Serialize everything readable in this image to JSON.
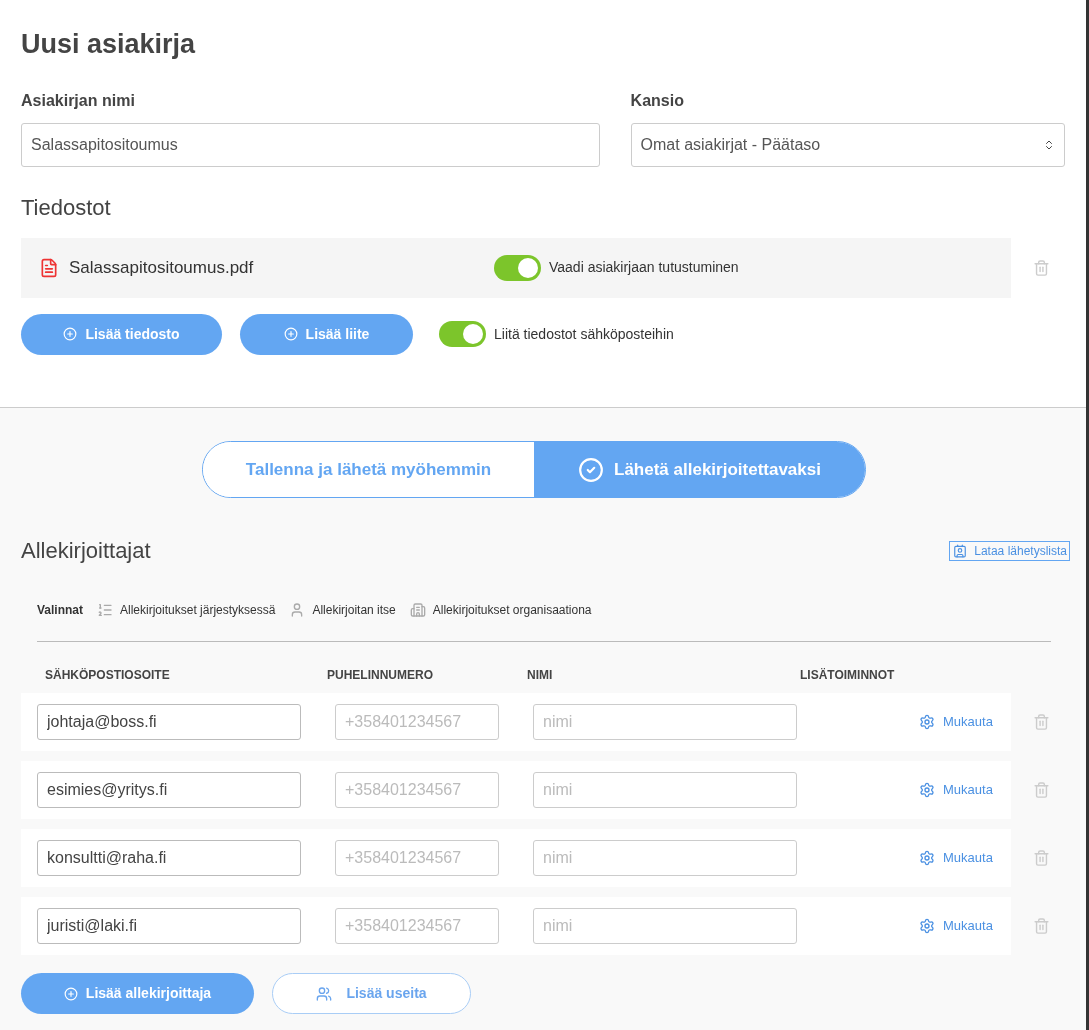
{
  "title": "Uusi asiakirja",
  "name_field": {
    "label": "Asiakirjan nimi",
    "value": "Salassapitositoumus"
  },
  "folder_field": {
    "label": "Kansio",
    "value": "Omat asiakirjat - Päätaso"
  },
  "files_heading": "Tiedostot",
  "files": [
    {
      "name": "Salassapitositoumus.pdf",
      "toggle_label": "Vaadi asiakirjaan tutustuminen",
      "on": true
    }
  ],
  "file_buttons": [
    "Lisää tiedosto",
    "Lisää liite"
  ],
  "attach_toggle": {
    "label": "Liitä tiedostot sähköposteihin",
    "on": true
  },
  "send_modes": [
    {
      "label": "Tallenna ja lähetä myöhemmin",
      "selected": false
    },
    {
      "label": "Lähetä allekirjoitettavaksi",
      "selected": true
    }
  ],
  "signers_heading": "Allekirjoittajat",
  "download_link": "Lataa lähetyslista",
  "options_label": "Valinnat",
  "options": [
    {
      "kind": "order",
      "label": "Allekirjoitukset järjestyksessä"
    },
    {
      "kind": "self",
      "label": "Allekirjoitan itse"
    },
    {
      "kind": "org",
      "label": "Allekirjoitukset organisaationa"
    }
  ],
  "columns": [
    "SÄHKÖPOSTIOSOITE",
    "PUHELINNUMERO",
    "NIMI",
    "LISÄTOIMINNOT"
  ],
  "signers": [
    {
      "email": "johtaja@boss.fi",
      "phone_placeholder": "+358401234567",
      "name_placeholder": "nimi",
      "action": "Mukauta"
    },
    {
      "email": "esimies@yritys.fi",
      "phone_placeholder": "+358401234567",
      "name_placeholder": "nimi",
      "action": "Mukauta"
    },
    {
      "email": "konsultti@raha.fi",
      "phone_placeholder": "+358401234567",
      "name_placeholder": "nimi",
      "action": "Mukauta"
    },
    {
      "email": "juristi@laki.fi",
      "phone_placeholder": "+358401234567",
      "name_placeholder": "nimi",
      "action": "Mukauta"
    }
  ],
  "signer_buttons": [
    {
      "kind": "primary",
      "label": "Lisää allekirjoittaja"
    },
    {
      "kind": "outline",
      "label": "Lisää useita"
    }
  ]
}
